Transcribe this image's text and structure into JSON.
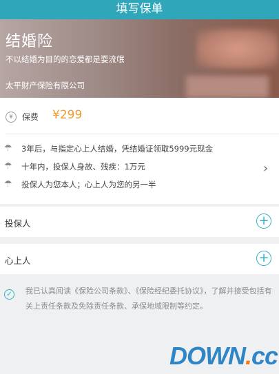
{
  "header": {
    "title": "填写保单"
  },
  "banner": {
    "title": "结婚险",
    "subtitle": "不以结婚为目的的恋爱都是耍流氓",
    "company": "太平财产保险有限公司"
  },
  "fee": {
    "icon": "yen-icon",
    "label": "保费",
    "value": "¥299"
  },
  "terms": [
    {
      "icon": "umbrella-icon",
      "text": "3年后，与指定心上人结婚，凭结婚证领取5999元现金"
    },
    {
      "icon": "umbrella-icon",
      "text": "十年内，投保人身故、残疾：1万元"
    },
    {
      "icon": "umbrella-icon",
      "text": "投保人为您本人；心上人为您的另一半"
    }
  ],
  "rows": {
    "policyholder": {
      "label": "投保人"
    },
    "sweetheart": {
      "label": "心上人"
    }
  },
  "agreement": {
    "text": "我已认真阅读《保险公司条款》、《保险经纪委托协议》，了解并接受包括有关上责任条款及免除责任条款、承保地域限制等约定。"
  },
  "watermark": {
    "main": "DOWN",
    "dot": ".",
    "tld": "cc"
  },
  "colors": {
    "accent": "#2fa6b9",
    "price": "#f39b2c"
  }
}
